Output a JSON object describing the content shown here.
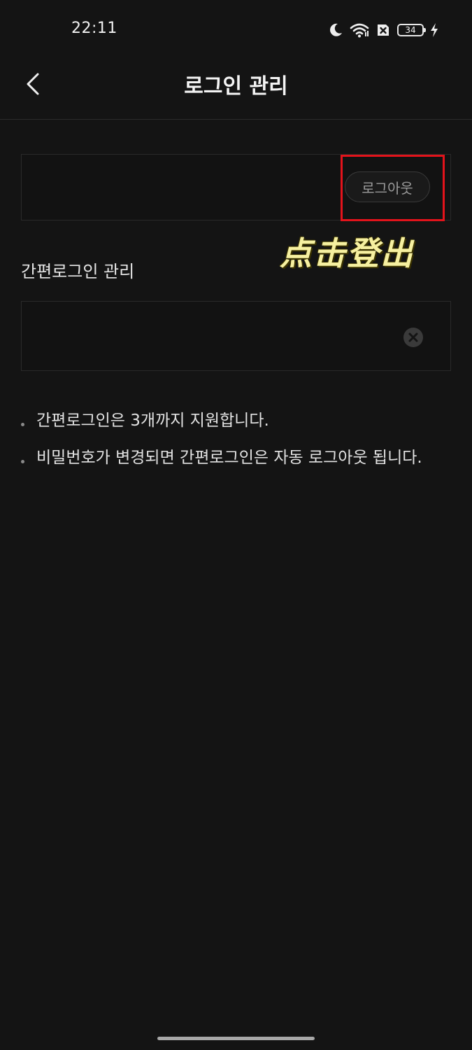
{
  "status_bar": {
    "time": "22:11",
    "battery_level": "34",
    "icons": [
      "moon-icon",
      "wifi-icon",
      "sim-blocked-icon",
      "battery-icon",
      "charging-bolt-icon"
    ]
  },
  "header": {
    "title": "로그인 관리",
    "back_icon": "chevron-left-icon"
  },
  "account": {
    "logout_label": "로그아웃"
  },
  "annotation": {
    "text": "点击登出",
    "highlight_color": "#e3131b",
    "text_color": "#f6f0a0"
  },
  "simple_login": {
    "section_title": "간편로그인 관리",
    "remove_icon": "close-circle-icon"
  },
  "notes": [
    "간편로그인은 3개까지 지원합니다.",
    "비밀번호가 변경되면 간편로그인은 자동 로그아웃 됩니다."
  ],
  "colors": {
    "background": "#141414",
    "card_border": "#2a2a2a",
    "text": "#e6e6e6"
  }
}
